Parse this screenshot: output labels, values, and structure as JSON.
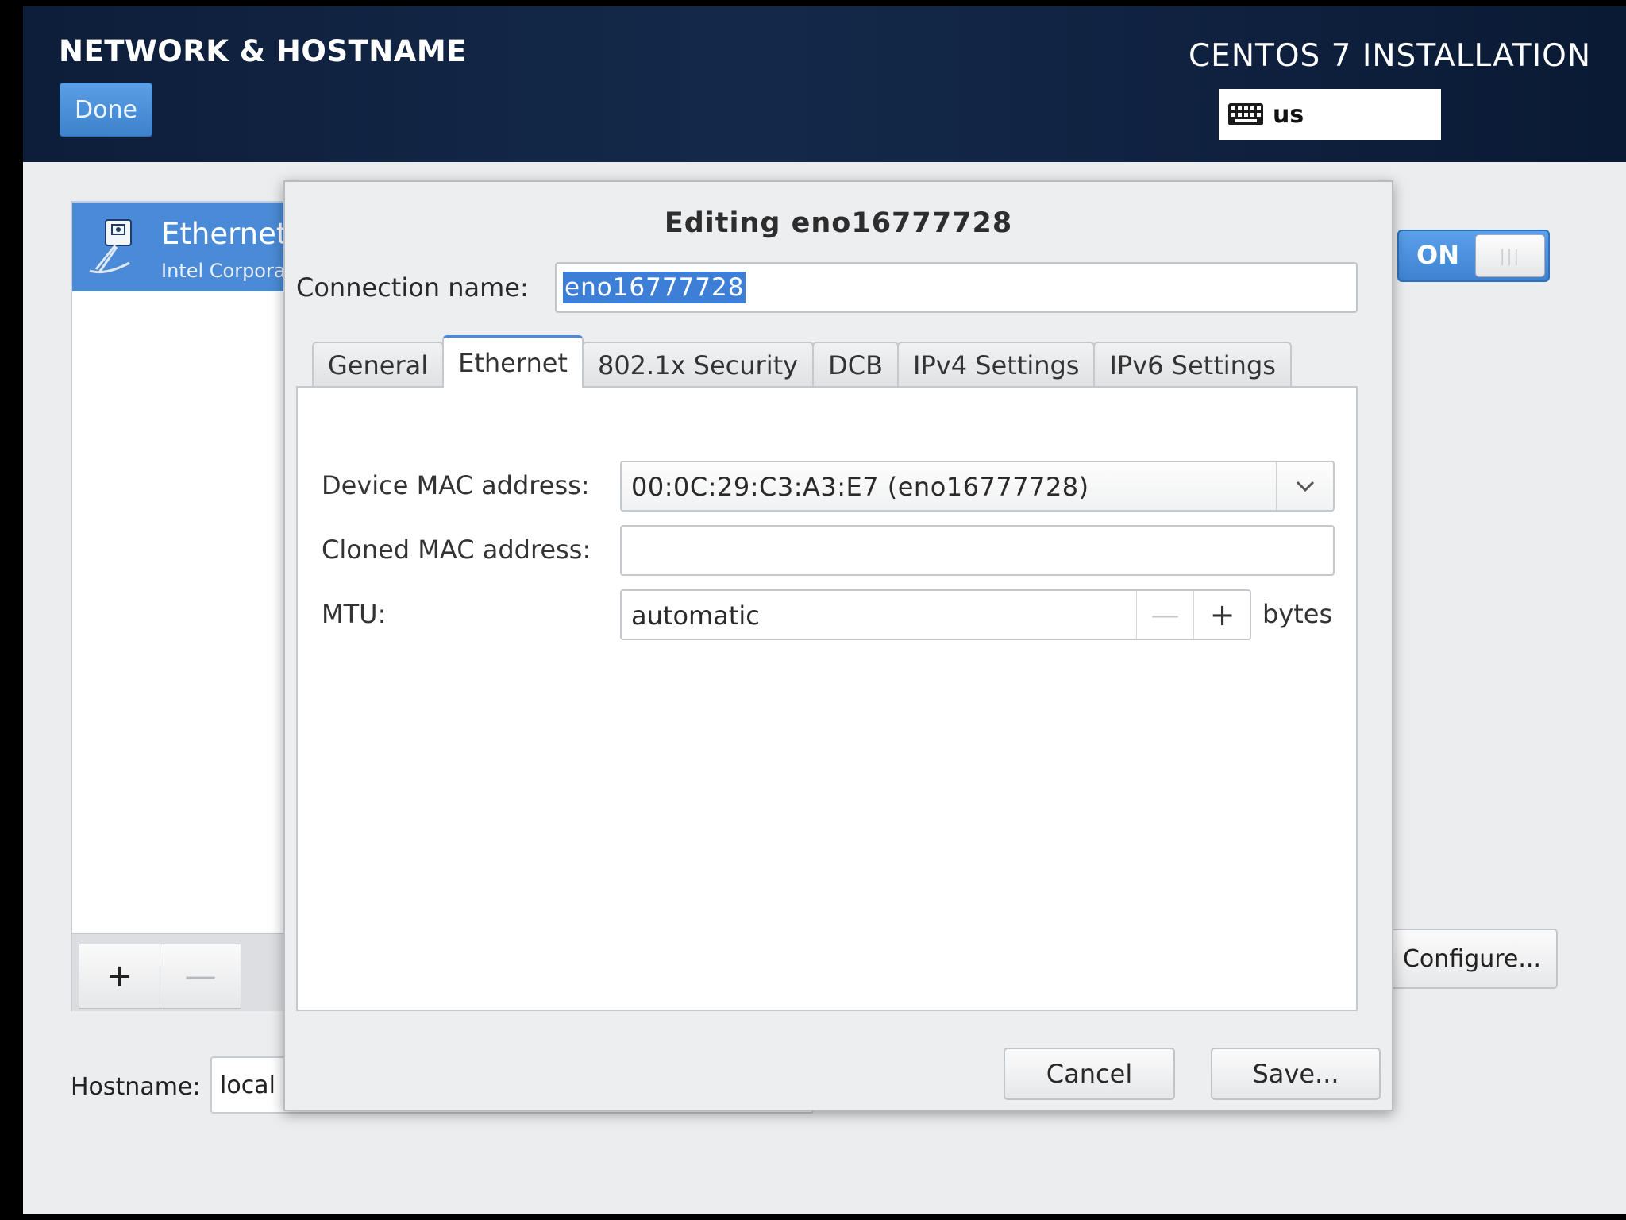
{
  "header": {
    "title": "NETWORK & HOSTNAME",
    "done_label": "Done",
    "product": "CENTOS 7 INSTALLATION",
    "keyboard_layout": "us"
  },
  "devices": [
    {
      "name": "Ethernet",
      "vendor": "Intel Corpora"
    }
  ],
  "list_toolbar": {
    "add_label": "+",
    "remove_label": "—"
  },
  "hostname": {
    "label": "Hostname:",
    "value": "local"
  },
  "toggle": {
    "label": "ON",
    "state": "on"
  },
  "configure_label": "Configure...",
  "dialog": {
    "title": "Editing eno16777728",
    "connection_name_label": "Connection name:",
    "connection_name_value": "eno16777728",
    "tabs": [
      {
        "label": "General"
      },
      {
        "label": "Ethernet",
        "active": true
      },
      {
        "label": "802.1x Security"
      },
      {
        "label": "DCB"
      },
      {
        "label": "IPv4 Settings"
      },
      {
        "label": "IPv6 Settings"
      }
    ],
    "device_mac_label": "Device MAC address:",
    "device_mac_value": "00:0C:29:C3:A3:E7 (eno16777728)",
    "cloned_mac_label": "Cloned MAC address:",
    "cloned_mac_value": "",
    "mtu_label": "MTU:",
    "mtu_value": "automatic",
    "mtu_unit": "bytes",
    "cancel_label": "Cancel",
    "save_label": "Save..."
  },
  "colors": {
    "accent": "#4a8ad6",
    "header_bg": "#14294a",
    "selection": "#3d7fd6"
  }
}
